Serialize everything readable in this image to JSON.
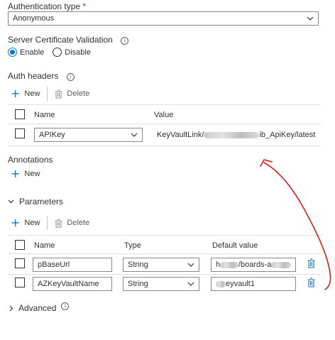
{
  "auth": {
    "label": "Authentication type",
    "required_mark": "*",
    "value": "Anonymous"
  },
  "cert": {
    "label": "Server Certificate Validation",
    "enable_label": "Enable",
    "disable_label": "Disable",
    "selected": "Enable"
  },
  "auth_headers": {
    "label": "Auth headers",
    "new_label": "New",
    "delete_label": "Delete",
    "columns": [
      "Name",
      "Value"
    ],
    "rows": [
      {
        "name": "APIKey",
        "value_start": "KeyVaultLink/",
        "value_end": "ib_ApiKey/latest"
      }
    ]
  },
  "annotations": {
    "label": "Annotations",
    "new_label": "New"
  },
  "parameters": {
    "label": "Parameters",
    "new_label": "New",
    "delete_label": "Delete",
    "columns": [
      "Name",
      "Type",
      "Default value"
    ],
    "rows": [
      {
        "name": "pBaseUrl",
        "type": "String",
        "default_start": "h",
        "default_end": "/boards-a"
      },
      {
        "name": "AZKeyVaultName",
        "type": "String",
        "default_start": "",
        "default_end": "eyvault1"
      }
    ]
  },
  "advanced": {
    "label": "Advanced"
  },
  "colors": {
    "accent": "#0078d4",
    "annotation_stroke": "#e0190f"
  },
  "icons": {
    "info": "info-icon",
    "chevron": "chevron-down-icon",
    "add": "plus-icon",
    "delete": "trash-icon"
  }
}
